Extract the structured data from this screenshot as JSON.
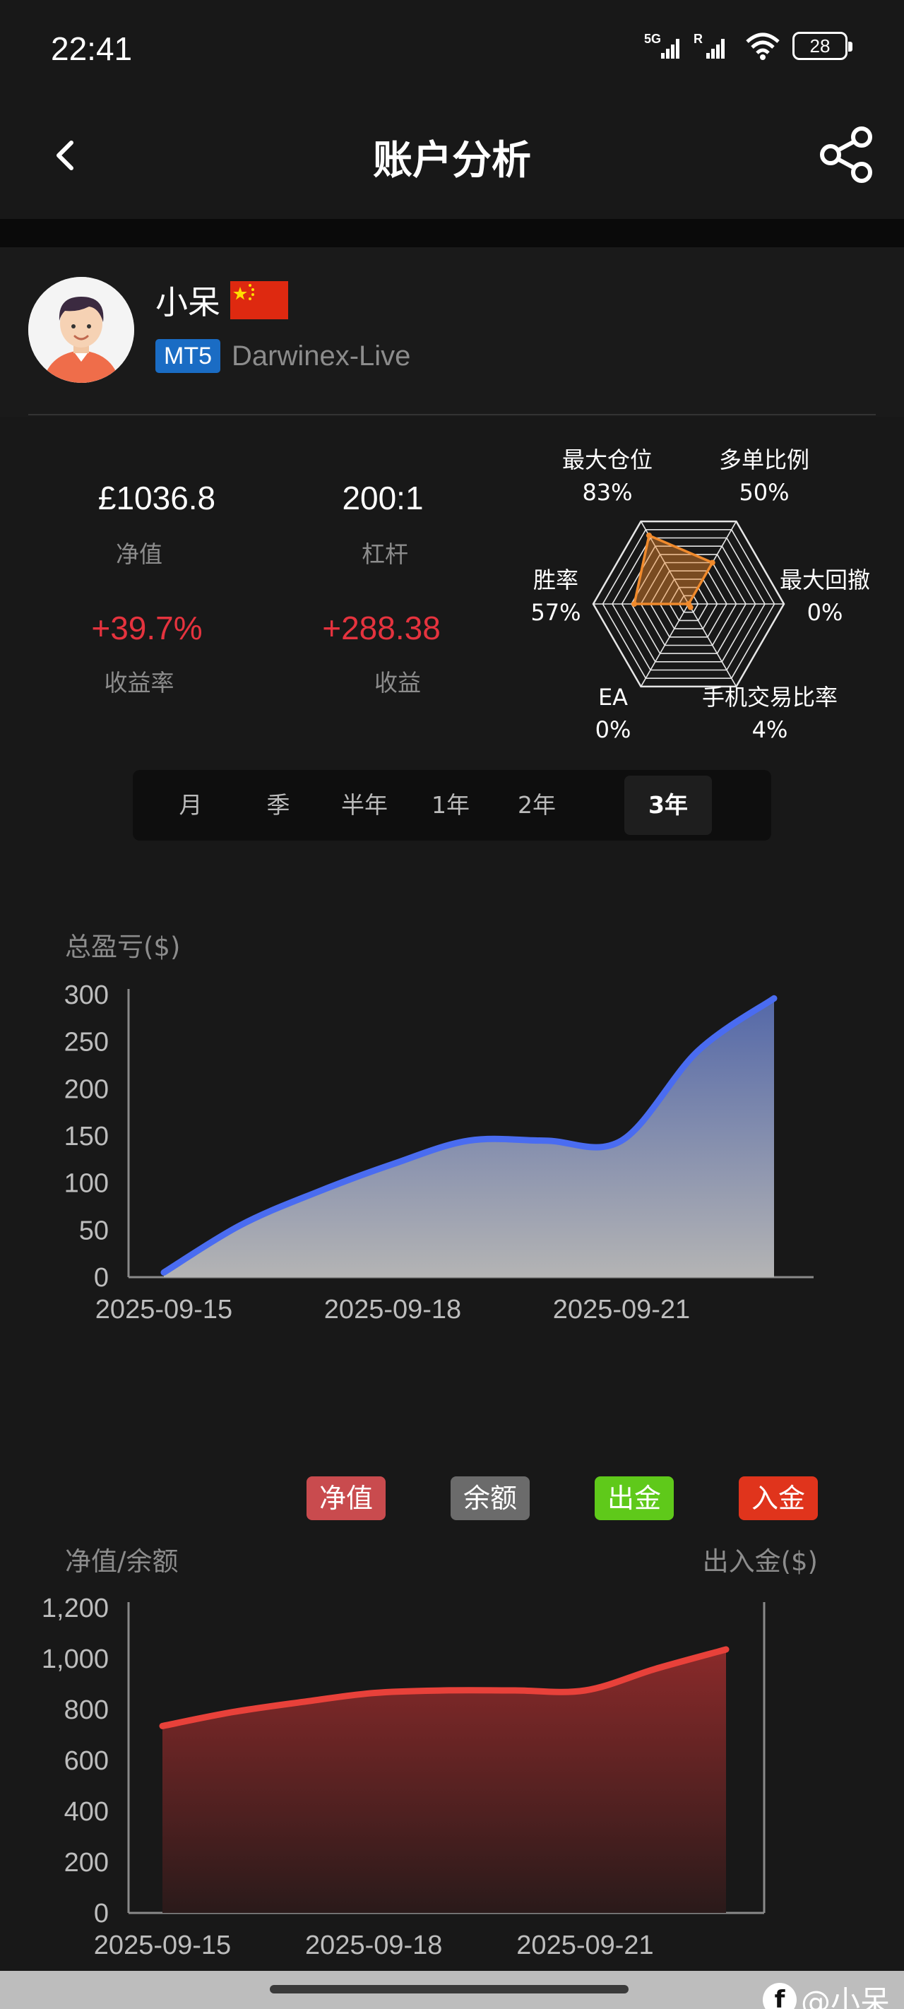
{
  "status_bar": {
    "time": "22:41",
    "network_1": "5G",
    "network_2": "R",
    "battery": "28"
  },
  "header": {
    "title": "账户分析",
    "back_icon": "chevron-left-icon",
    "share_icon": "share-icon"
  },
  "profile": {
    "name": "小呆",
    "flag": "china-flag",
    "platform_badge": "MT5",
    "server": "Darwinex-Live"
  },
  "stats": {
    "equity_value": "£1036.8",
    "equity_label": "净值",
    "leverage_value": "200:1",
    "leverage_label": "杠杆",
    "return_rate_value": "+39.7%",
    "return_rate_label": "收益率",
    "profit_value": "+288.38",
    "profit_label": "收益",
    "positive_color": "#e5333e"
  },
  "radar": {
    "axes": [
      {
        "label": "最大仓位",
        "value_text": "83%",
        "value": 83
      },
      {
        "label": "多单比例",
        "value_text": "50%",
        "value": 50
      },
      {
        "label": "最大回撤",
        "value_text": "0%",
        "value": 0
      },
      {
        "label": "手机交易比率",
        "value_text": "4%",
        "value": 4
      },
      {
        "label": "EA",
        "value_text": "0%",
        "value": 0
      },
      {
        "label": "胜率",
        "value_text": "57%",
        "value": 57
      }
    ],
    "color": "#f08a2c"
  },
  "period_tabs": [
    {
      "label": "月",
      "active": false
    },
    {
      "label": "季",
      "active": false
    },
    {
      "label": "半年",
      "active": false
    },
    {
      "label": "1年",
      "active": false
    },
    {
      "label": "2年",
      "active": false
    },
    {
      "label": "3年",
      "active": true
    }
  ],
  "chart_data": [
    {
      "type": "area",
      "ylabel": "总盈亏($)",
      "ylim": [
        0,
        300
      ],
      "yticks": [
        "0",
        "50",
        "100",
        "150",
        "200",
        "250",
        "300"
      ],
      "x_tick_labels": [
        "2025-09-15",
        "2025-09-18",
        "2025-09-21"
      ],
      "x": [
        "2025-09-15",
        "2025-09-16",
        "2025-09-17",
        "2025-09-18",
        "2025-09-19",
        "2025-09-20",
        "2025-09-21",
        "2025-09-22",
        "2025-09-23"
      ],
      "series": [
        {
          "values": [
            5,
            55,
            90,
            120,
            145,
            145,
            145,
            240,
            296
          ]
        }
      ],
      "line_color": "#4a6cf0"
    },
    {
      "type": "area",
      "ylabel_left": "净值/余额",
      "ylabel_right": "出入金($)",
      "ylim": [
        0,
        1200
      ],
      "yticks": [
        "0",
        "200",
        "400",
        "600",
        "800",
        "1,000",
        "1,200"
      ],
      "x_tick_labels": [
        "2025-09-15",
        "2025-09-18",
        "2025-09-21"
      ],
      "x": [
        "2025-09-15",
        "2025-09-16",
        "2025-09-17",
        "2025-09-18",
        "2025-09-19",
        "2025-09-20",
        "2025-09-21",
        "2025-09-22",
        "2025-09-23"
      ],
      "legend": [
        {
          "label": "净值",
          "color": "#c94b4e"
        },
        {
          "label": "余额",
          "color": "#6b6b6b"
        },
        {
          "label": "出金",
          "color": "#5fc91a"
        },
        {
          "label": "入金",
          "color": "#e0341c"
        }
      ],
      "series": [
        {
          "name": "净值",
          "values": [
            735,
            790,
            830,
            865,
            875,
            875,
            875,
            960,
            1036
          ]
        }
      ],
      "line_color": "#e8413a"
    }
  ],
  "watermark": {
    "text": "@小呆",
    "logo": "f"
  }
}
